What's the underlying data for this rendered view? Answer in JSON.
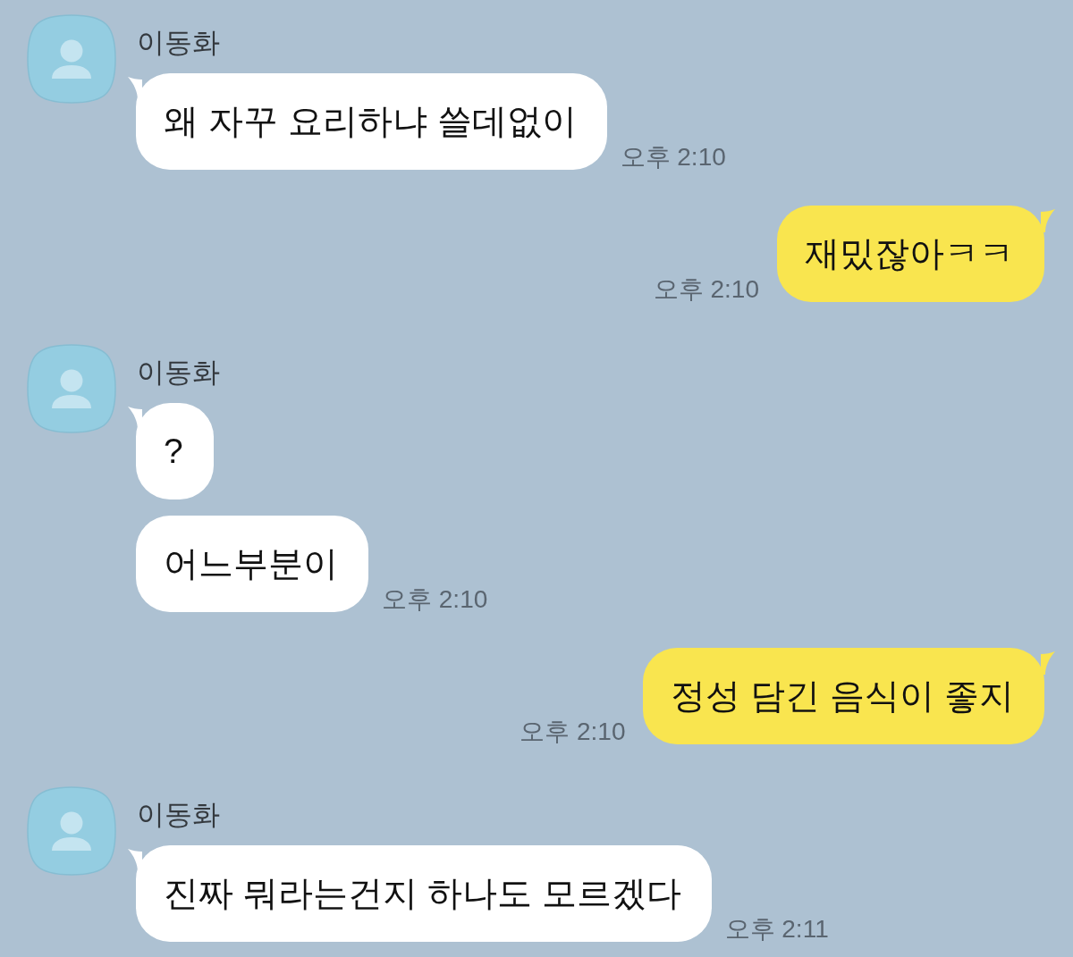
{
  "chat": [
    {
      "kind": "received",
      "sender": "이동화",
      "bubbles": [
        "왜 자꾸 요리하냐 쓸데없이"
      ],
      "time": "오후 2:10"
    },
    {
      "kind": "sent",
      "bubbles": [
        "재밌잖아ㅋㅋ"
      ],
      "time": "오후 2:10"
    },
    {
      "kind": "received",
      "sender": "이동화",
      "bubbles": [
        "?",
        "어느부분이"
      ],
      "time": "오후 2:10"
    },
    {
      "kind": "sent",
      "bubbles": [
        "정성 담긴 음식이 좋지"
      ],
      "time": "오후 2:10"
    },
    {
      "kind": "received",
      "sender": "이동화",
      "bubbles": [
        "진짜 뭐라는건지 하나도 모르겠다"
      ],
      "time": "오후 2:11"
    }
  ]
}
